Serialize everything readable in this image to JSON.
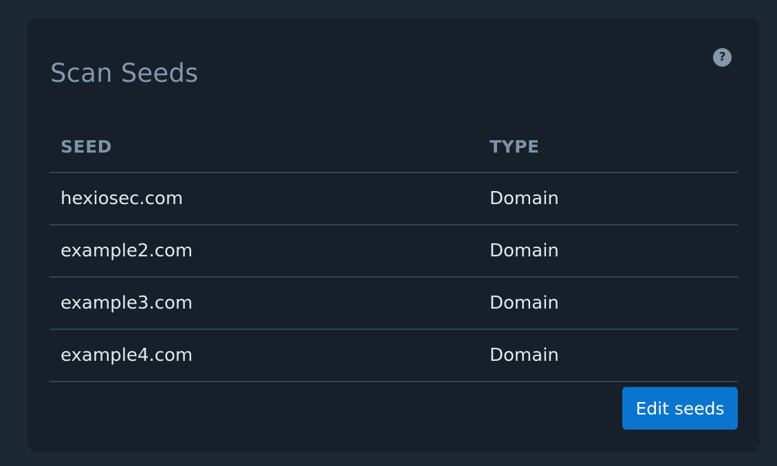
{
  "card": {
    "title": "Scan Seeds",
    "help_icon": "?"
  },
  "table": {
    "headers": [
      "SEED",
      "TYPE"
    ],
    "rows": [
      {
        "seed": "hexiosec.com",
        "type": "Domain"
      },
      {
        "seed": "example2.com",
        "type": "Domain"
      },
      {
        "seed": "example3.com",
        "type": "Domain"
      },
      {
        "seed": "example4.com",
        "type": "Domain"
      }
    ]
  },
  "actions": {
    "edit_label": "Edit seeds"
  },
  "colors": {
    "page_bg": "#1c2833",
    "card_bg": "#17202a",
    "accent": "#0a75cf"
  }
}
